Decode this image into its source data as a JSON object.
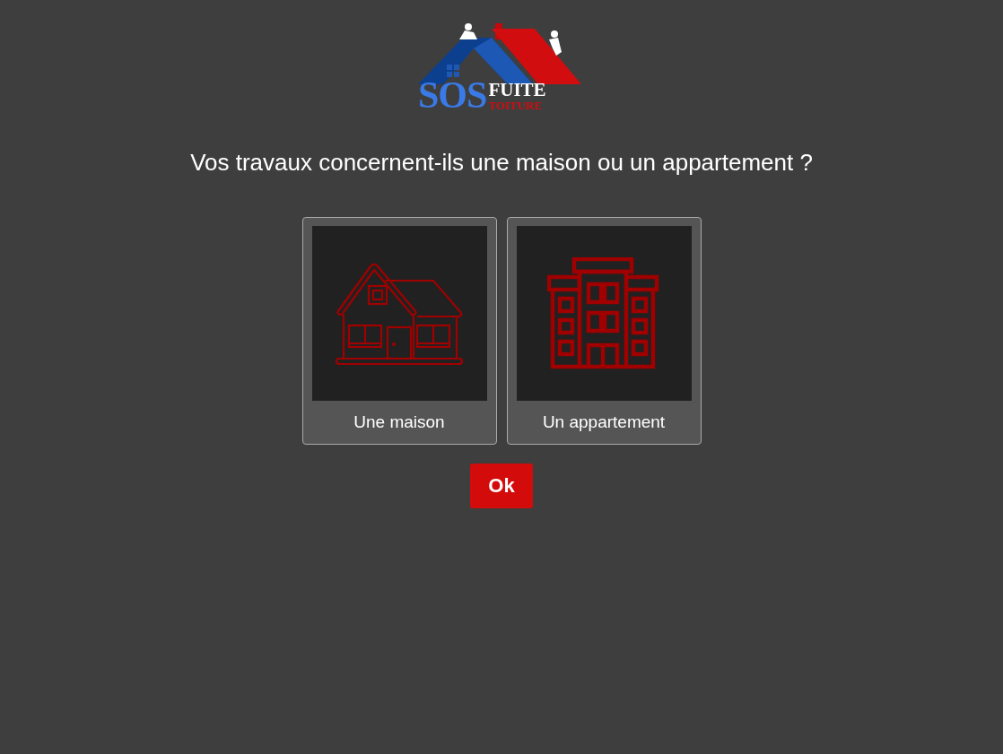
{
  "logo": {
    "main": "SOS",
    "line_1": "FUITE",
    "line_2": "TOITURE"
  },
  "question": "Vos travaux concernent-ils une maison ou un appartement ?",
  "options": [
    {
      "kind": "house",
      "label": "Une maison",
      "selected": false
    },
    {
      "kind": "building",
      "label": "Un appartement",
      "selected": false
    }
  ],
  "submit": "Ok"
}
